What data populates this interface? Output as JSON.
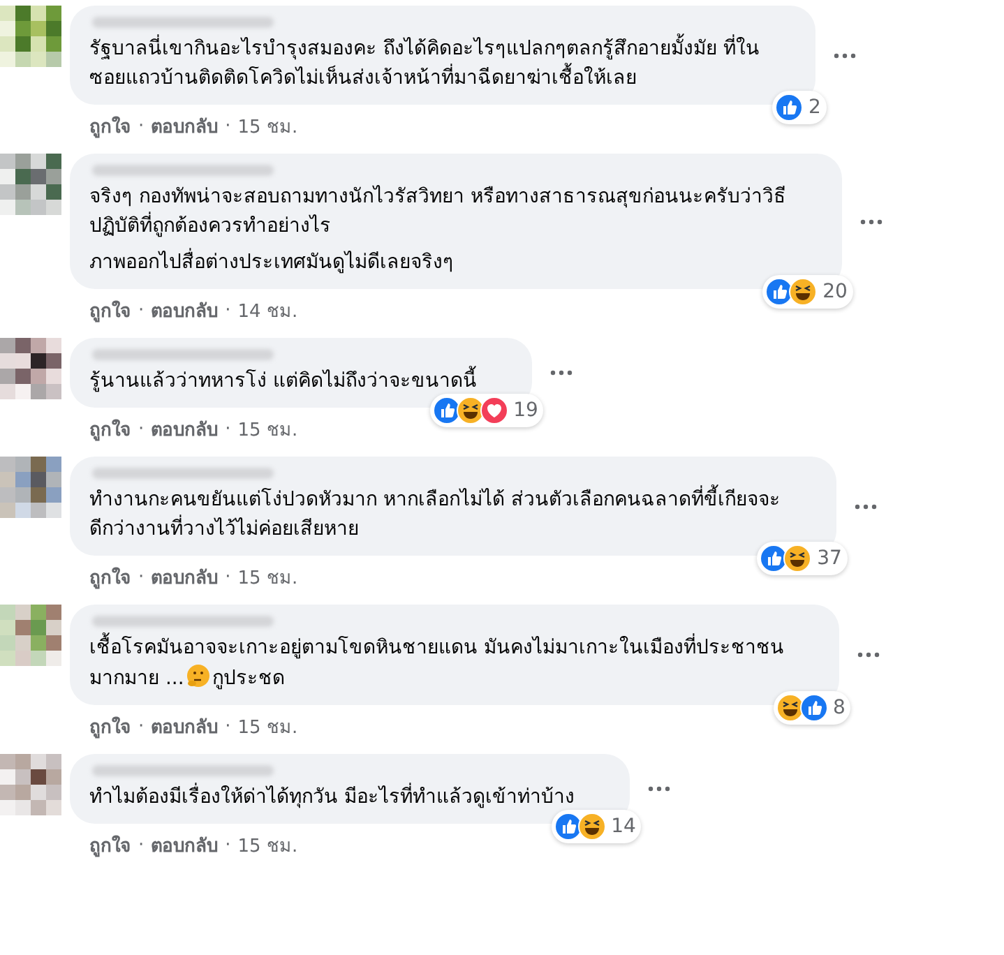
{
  "comments": [
    {
      "paragraphs": [
        {
          "lines": [
            [
              {
                "kind": "text",
                "text": "รัฐบาลนี่เขากินอะไรบำรุงสมองคะ ถึงได้คิดอะไรๆแปลกๆตลกรู้สึกอายมั้งมัย ที่ใน"
              }
            ],
            [
              {
                "kind": "text",
                "text": "ซอยแถวบ้านติดติดโควิดไม่เห็นส่งเจ้าหน้าที่มาฉีดยาฆ่าเชื้อให้เลย"
              }
            ]
          ]
        }
      ],
      "reactions": [
        {
          "kind": "like"
        }
      ],
      "reaction_count": "2",
      "like": "ถูกใจ",
      "separators": [
        "·",
        "·"
      ],
      "reply": "ตอบกลับ",
      "time": "15 ชม."
    },
    {
      "paragraphs": [
        {
          "lines": [
            [
              {
                "kind": "text",
                "text": "จริงๆ กองทัพน่าจะสอบถามทางนักไวรัสวิทยา หรือทางสาธารณสุขก่อนนะครับว่าวิธี"
              }
            ],
            [
              {
                "kind": "text",
                "text": "ปฏิบัติที่ถูกต้องควรทำอย่างไร"
              }
            ]
          ]
        },
        {
          "lines": [
            [
              {
                "kind": "text",
                "text": "ภาพออกไปสื่อต่างประเทศมันดูไม่ดีเลยจริงๆ"
              }
            ]
          ]
        }
      ],
      "reactions": [
        {
          "kind": "like"
        },
        {
          "kind": "haha"
        }
      ],
      "reaction_count": "20",
      "like": "ถูกใจ",
      "separators": [
        "·",
        "·"
      ],
      "reply": "ตอบกลับ",
      "time": "14 ชม."
    },
    {
      "paragraphs": [
        {
          "lines": [
            [
              {
                "kind": "text",
                "text": "รู้นานแล้วว่าทหารโง่ แต่คิดไม่ถึงว่าจะขนาดนี้"
              }
            ]
          ]
        }
      ],
      "reactions": [
        {
          "kind": "like"
        },
        {
          "kind": "haha"
        },
        {
          "kind": "love"
        }
      ],
      "reaction_count": "19",
      "like": "ถูกใจ",
      "separators": [
        "·",
        "·"
      ],
      "reply": "ตอบกลับ",
      "time": "15 ชม."
    },
    {
      "paragraphs": [
        {
          "lines": [
            [
              {
                "kind": "text",
                "text": "ทำงานกะคนขยันแต่โง่ปวดหัวมาก หากเลือกไม่ได้ ส่วนตัวเลือกคนฉลาดที่ขี้เกียจจะ"
              }
            ],
            [
              {
                "kind": "text",
                "text": "ดีกว่างานที่วางไว้ไม่ค่อยเสียหาย"
              }
            ]
          ]
        }
      ],
      "reactions": [
        {
          "kind": "like"
        },
        {
          "kind": "haha"
        }
      ],
      "reaction_count": "37",
      "like": "ถูกใจ",
      "separators": [
        "·",
        "·"
      ],
      "reply": "ตอบกลับ",
      "time": "15 ชม."
    },
    {
      "paragraphs": [
        {
          "lines": [
            [
              {
                "kind": "text",
                "text": "เชื้อโรคมันอาจจะเกาะอยู่ตามโขดหินชายแดน มันคงไม่มาเกาะในเมืองที่ประชาชน"
              }
            ],
            [
              {
                "kind": "text",
                "text": "มากมาย ..."
              },
              {
                "kind": "emoji"
              },
              {
                "kind": "text",
                "text": "กูประชด"
              }
            ]
          ]
        }
      ],
      "reactions": [
        {
          "kind": "haha"
        },
        {
          "kind": "like"
        }
      ],
      "reaction_count": "8",
      "like": "ถูกใจ",
      "separators": [
        "·",
        "·"
      ],
      "reply": "ตอบกลับ",
      "time": "15 ชม."
    },
    {
      "paragraphs": [
        {
          "lines": [
            [
              {
                "kind": "text",
                "text": "ทำไมต้องมีเรื่องให้ด่าได้ทุกวัน มีอะไรที่ทำแล้วดูเข้าท่าบ้าง"
              }
            ]
          ]
        }
      ],
      "reactions": [
        {
          "kind": "like"
        },
        {
          "kind": "haha"
        }
      ],
      "reaction_count": "14",
      "like": "ถูกใจ",
      "separators": [
        "·",
        "·"
      ],
      "reply": "ตอบกลับ",
      "time": "15 ชม."
    }
  ]
}
